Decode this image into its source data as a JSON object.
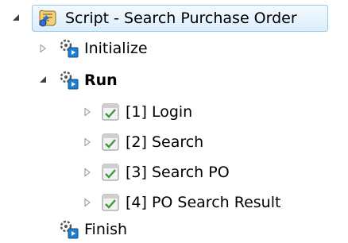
{
  "tree": {
    "root": {
      "label": "Script - Search Purchase Order",
      "icon": "script-icon",
      "expanded": true,
      "selected": true,
      "children": [
        {
          "label": "Initialize",
          "icon": "gear-step-icon",
          "expanded": false,
          "bold": false
        },
        {
          "label": "Run",
          "icon": "gear-step-icon",
          "expanded": true,
          "bold": true,
          "children": [
            {
              "label": "[1] Login",
              "icon": "page-step-icon",
              "expanded": false
            },
            {
              "label": "[2] Search",
              "icon": "page-step-icon",
              "expanded": false
            },
            {
              "label": "[3] Search PO",
              "icon": "page-step-icon",
              "expanded": false
            },
            {
              "label": "[4] PO Search Result",
              "icon": "page-step-icon",
              "expanded": false
            }
          ]
        },
        {
          "label": "Finish",
          "icon": "gear-step-icon",
          "expanded": false,
          "bold": false
        }
      ]
    }
  },
  "colors": {
    "selection_border": "#99c9ef",
    "selection_fill": "#dbeefc",
    "step_blue": "#1e7fd2",
    "page_green": "#3c9a3c"
  }
}
